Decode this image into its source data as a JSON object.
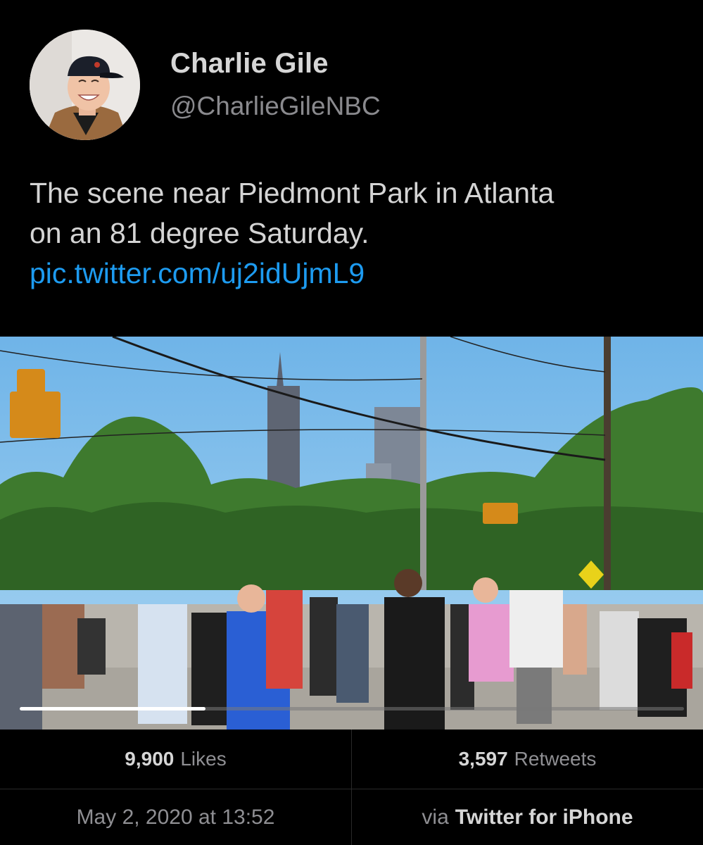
{
  "user": {
    "display_name": "Charlie Gile",
    "handle": "@CharlieGileNBC",
    "avatar_icon": "profile-photo"
  },
  "tweet": {
    "text_line1": "The scene near Piedmont Park in Atlanta",
    "text_line2": "on an 81 degree Saturday.",
    "link": "pic.twitter.com/uj2idUjmL9",
    "link_color": "#1d9bf0"
  },
  "media": {
    "type": "video",
    "progress": 0.28
  },
  "stats": {
    "likes_count": "9,900",
    "likes_label": "Likes",
    "retweets_count": "3,597",
    "retweets_label": "Retweets"
  },
  "meta": {
    "timestamp": "May 2, 2020 at 13:52",
    "via_prefix": "via",
    "via_app": "Twitter for iPhone"
  }
}
